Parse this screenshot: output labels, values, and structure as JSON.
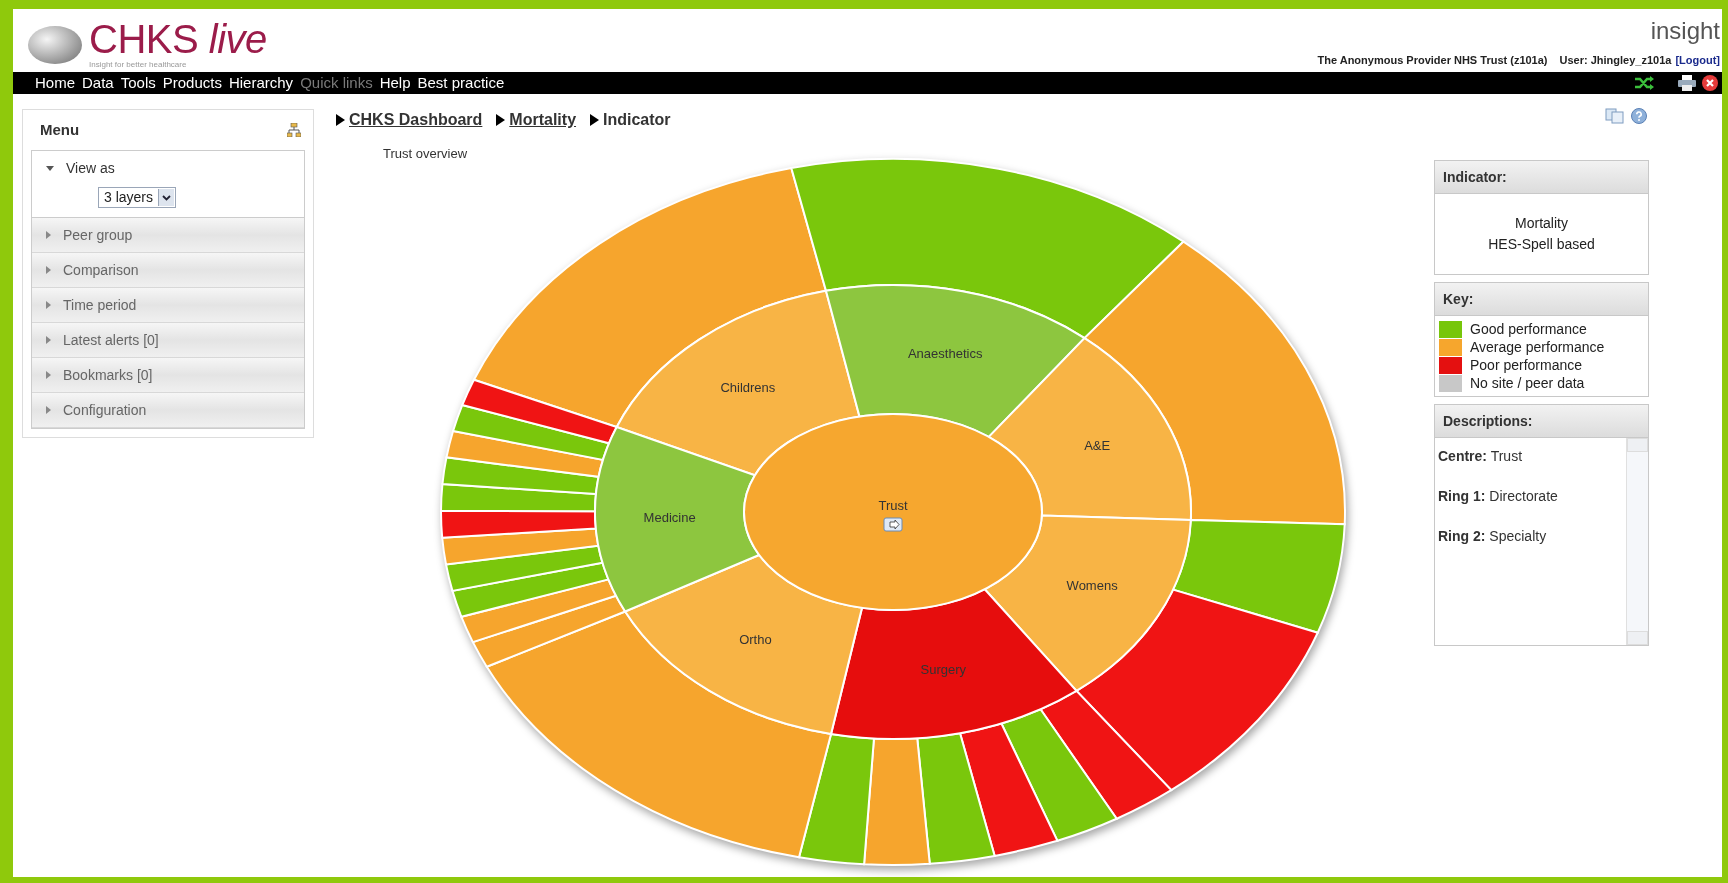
{
  "header": {
    "logo_text": "CHKS *live*",
    "tagline": "Insight for better healthcare",
    "brand": "insight",
    "trust": "The Anonymous Provider NHS Trust (z101a)",
    "user": "User: Jhingley_z101a",
    "logout": "[Logout]"
  },
  "nav": [
    {
      "label": "Home",
      "disabled": false
    },
    {
      "label": "Data",
      "disabled": false
    },
    {
      "label": "Tools",
      "disabled": false
    },
    {
      "label": "Products",
      "disabled": false
    },
    {
      "label": "Hierarchy",
      "disabled": false
    },
    {
      "label": "Quick links",
      "disabled": true
    },
    {
      "label": "Help",
      "disabled": false
    },
    {
      "label": "Best practice",
      "disabled": false
    }
  ],
  "menu": {
    "title": "Menu",
    "items": [
      {
        "label": "View as",
        "expanded": true,
        "select": "3 layers"
      },
      {
        "label": "Peer group",
        "expanded": false
      },
      {
        "label": "Comparison",
        "expanded": false
      },
      {
        "label": "Time period",
        "expanded": false
      },
      {
        "label": "Latest alerts [0]",
        "expanded": false
      },
      {
        "label": "Bookmarks [0]",
        "expanded": false
      },
      {
        "label": "Configuration",
        "expanded": false
      }
    ]
  },
  "breadcrumb": [
    {
      "label": "CHKS Dashboard",
      "link": true
    },
    {
      "label": "Mortality",
      "link": true
    },
    {
      "label": "Indicator",
      "link": false
    }
  ],
  "subtitle": "Trust overview",
  "sunburst": {
    "centre": {
      "label": "Trust",
      "color": "#f6a72f"
    },
    "ring": [
      {
        "label": "Childrens",
        "color": "#f8b445",
        "children": [
          {
            "color": "#f6a52d"
          }
        ]
      },
      {
        "label": "Anaesthetics",
        "color": "#8dc63f",
        "children": [
          {
            "color": "#7ac70c"
          }
        ]
      },
      {
        "label": "A&E",
        "color": "#f8b445",
        "children": [
          {
            "color": "#f6a52d"
          }
        ]
      },
      {
        "label": "Womens",
        "color": "#f8b445",
        "children": [
          {
            "color": "#7ac70c"
          },
          {
            "color": "#f01414"
          }
        ]
      },
      {
        "label": "Surgery",
        "color": "#e60d0d",
        "children": [
          {
            "color": "#f01414"
          },
          {
            "color": "#7ac70c"
          },
          {
            "color": "#f01414"
          },
          {
            "color": "#7ac70c"
          },
          {
            "color": "#f6a52d"
          },
          {
            "color": "#7ac70c"
          }
        ]
      },
      {
        "label": "Ortho",
        "color": "#f8b445",
        "children": [
          {
            "color": "#f6a52d"
          }
        ]
      },
      {
        "label": "Medicine",
        "color": "#8dc63f",
        "children": [
          {
            "color": "#f6a52d"
          },
          {
            "color": "#f6a52d"
          },
          {
            "color": "#7ac70c"
          },
          {
            "color": "#7ac70c"
          },
          {
            "color": "#f6a52d"
          },
          {
            "color": "#f01414"
          },
          {
            "color": "#7ac70c"
          },
          {
            "color": "#7ac70c"
          },
          {
            "color": "#f6a52d"
          },
          {
            "color": "#7ac70c"
          },
          {
            "color": "#f01414"
          }
        ]
      }
    ]
  },
  "indicator": {
    "title": "Indicator:",
    "lines": [
      "Mortality",
      "HES-Spell based"
    ]
  },
  "key": {
    "title": "Key:",
    "items": [
      {
        "label": "Good performance",
        "color": "#77c60a"
      },
      {
        "label": "Average performance",
        "color": "#f6a62d"
      },
      {
        "label": "Poor performance",
        "color": "#e41010"
      },
      {
        "label": "No site / peer data",
        "color": "#c8c8c8"
      }
    ]
  },
  "descriptions": {
    "title": "Descriptions:",
    "items": [
      "**Centre:** Trust",
      "**Ring 1:** Directorate",
      "**Ring 2:** Specialty"
    ]
  }
}
